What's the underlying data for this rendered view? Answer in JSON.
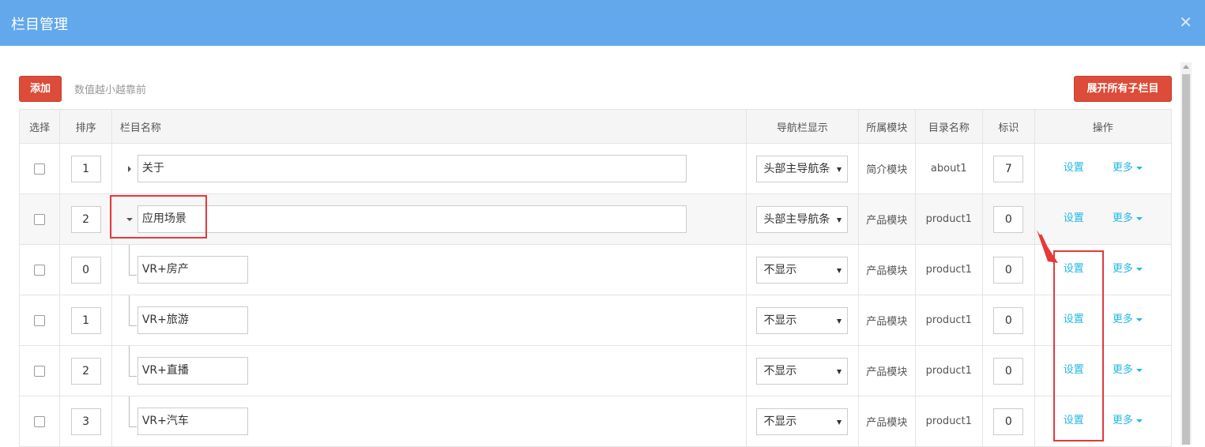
{
  "window": {
    "title": "栏目管理"
  },
  "toolbar": {
    "add_label": "添加",
    "hint": "数值越小越靠前",
    "expand_label": "展开所有子栏目"
  },
  "table": {
    "headers": {
      "select": "选择",
      "order": "排序",
      "name": "栏目名称",
      "nav": "导航栏显示",
      "module": "所属模块",
      "dir": "目录名称",
      "flag": "标识",
      "ops": "操作"
    },
    "op_labels": {
      "settings": "设置",
      "more": "更多"
    },
    "rows": [
      {
        "order": "1",
        "name": "关于",
        "nav": "头部主导航条",
        "module": "简介模块",
        "dir": "about1",
        "flag": "7",
        "level": 0,
        "expanded": false
      },
      {
        "order": "2",
        "name": "应用场景",
        "nav": "头部主导航条",
        "module": "产品模块",
        "dir": "product1",
        "flag": "0",
        "level": 0,
        "expanded": true
      },
      {
        "order": "0",
        "name": "VR+房产",
        "nav": "不显示",
        "module": "产品模块",
        "dir": "product1",
        "flag": "0",
        "level": 1
      },
      {
        "order": "1",
        "name": "VR+旅游",
        "nav": "不显示",
        "module": "产品模块",
        "dir": "product1",
        "flag": "0",
        "level": 1
      },
      {
        "order": "2",
        "name": "VR+直播",
        "nav": "不显示",
        "module": "产品模块",
        "dir": "product1",
        "flag": "0",
        "level": 1
      },
      {
        "order": "3",
        "name": "VR+汽车",
        "nav": "不显示",
        "module": "产品模块",
        "dir": "product1",
        "flag": "0",
        "level": 1
      }
    ]
  },
  "annotation_color": "#e5393a",
  "accent_color": "#62a8ea"
}
